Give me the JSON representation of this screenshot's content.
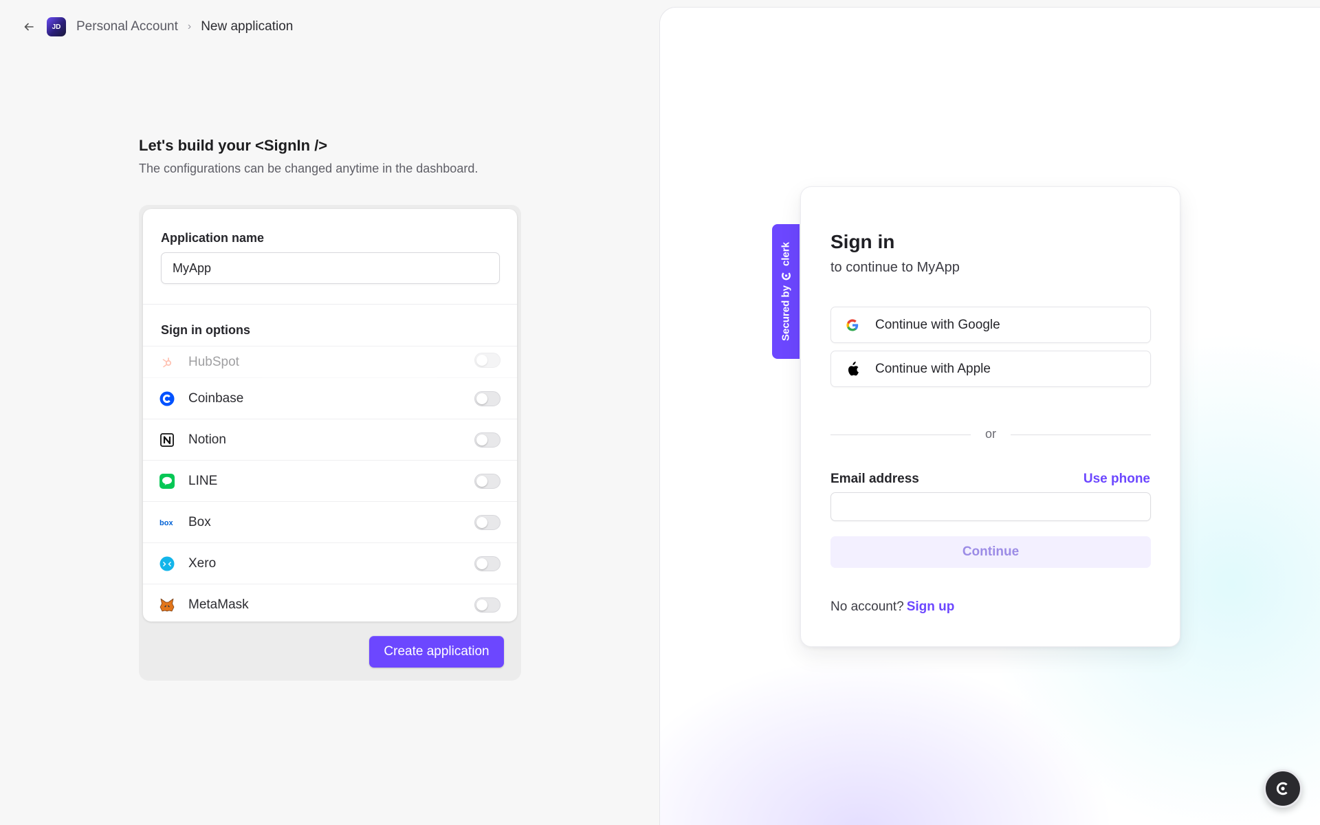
{
  "breadcrumb": {
    "avatar_initials": "JD",
    "account": "Personal Account",
    "current": "New application"
  },
  "intro": {
    "title": "Let's build your <SignIn />",
    "subtitle": "The configurations can be changed anytime in the dashboard."
  },
  "form": {
    "app_name_label": "Application name",
    "app_name_value": "MyApp",
    "sign_in_options_label": "Sign in options",
    "options": [
      {
        "label": "HubSpot",
        "icon": "hubspot-icon",
        "enabled": false
      },
      {
        "label": "Coinbase",
        "icon": "coinbase-icon",
        "enabled": false
      },
      {
        "label": "Notion",
        "icon": "notion-icon",
        "enabled": false
      },
      {
        "label": "LINE",
        "icon": "line-icon",
        "enabled": false
      },
      {
        "label": "Box",
        "icon": "box-icon",
        "enabled": false
      },
      {
        "label": "Xero",
        "icon": "xero-icon",
        "enabled": false
      },
      {
        "label": "MetaMask",
        "icon": "metamask-icon",
        "enabled": false
      }
    ],
    "create_button": "Create application"
  },
  "preview": {
    "secured_by": "Secured by",
    "brand": "clerk",
    "title": "Sign in",
    "subtitle": "to continue to MyApp",
    "google_button": "Continue with Google",
    "apple_button": "Continue with Apple",
    "divider": "or",
    "email_label": "Email address",
    "use_phone": "Use phone",
    "email_value": "",
    "continue_button": "Continue",
    "no_account": "No account?",
    "sign_up": "Sign up"
  },
  "colors": {
    "accent": "#6c47ff",
    "background": "#f7f7f7"
  }
}
